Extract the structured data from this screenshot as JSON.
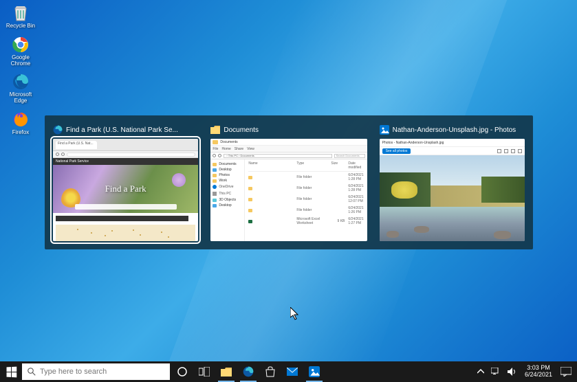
{
  "desktop_icons": [
    {
      "label": "Recycle Bin",
      "icon": "recycle-bin"
    },
    {
      "label": "Google Chrome",
      "icon": "chrome"
    },
    {
      "label": "Microsoft Edge",
      "icon": "edge"
    },
    {
      "label": "Firefox",
      "icon": "firefox"
    }
  ],
  "alttab": {
    "windows": [
      {
        "title": "Find a Park (U.S. National Park Se...",
        "app_icon": "edge",
        "selected": true
      },
      {
        "title": "Documents",
        "app_icon": "folder",
        "selected": false
      },
      {
        "title": "Nathan-Anderson-Unsplash.jpg - Photos",
        "app_icon": "photos",
        "selected": false
      }
    ]
  },
  "browser_thumb": {
    "tab_title": "Find a Park (U.S. Nat...",
    "site_bar": "National Park Service",
    "hero_title": "Find a Park"
  },
  "explorer_thumb": {
    "title": "Documents",
    "ribbon": [
      "File",
      "Home",
      "Share",
      "View"
    ],
    "path": "› This PC › Documents",
    "search_ph": "Search Documents",
    "sidebar_quick": [
      {
        "label": "Documents",
        "color": "#f5c860"
      },
      {
        "label": "Desktop",
        "color": "#4aa8e8"
      },
      {
        "label": "Photos",
        "color": "#f5c860"
      },
      {
        "label": "Work",
        "color": "#f5c860"
      }
    ],
    "sidebar_groups": [
      "OneDrive",
      "This PC",
      "3D Objects",
      "Desktop"
    ],
    "columns": [
      "Name",
      "Type",
      "Size",
      "Date modified"
    ],
    "files": [
      {
        "name": "",
        "type": "File folder",
        "size": "",
        "date": "6/24/2021 1:28 PM"
      },
      {
        "name": "",
        "type": "File folder",
        "size": "",
        "date": "6/24/2021 1:28 PM"
      },
      {
        "name": "",
        "type": "File folder",
        "size": "",
        "date": "6/24/2021 12:07 PM"
      },
      {
        "name": "",
        "type": "File folder",
        "size": "",
        "date": "6/24/2021 1:26 PM"
      },
      {
        "name": "",
        "type": "Microsoft Excel Worksheet",
        "size": "9 KB",
        "date": "6/24/2021 1:27 PM"
      }
    ]
  },
  "photos_thumb": {
    "title": "Photos - Nathan-Anderson-Unsplash.jpg",
    "button": "See all photos"
  },
  "taskbar": {
    "search_placeholder": "Type here to search",
    "clock_time": "3:03 PM",
    "clock_date": "6/24/2021"
  }
}
